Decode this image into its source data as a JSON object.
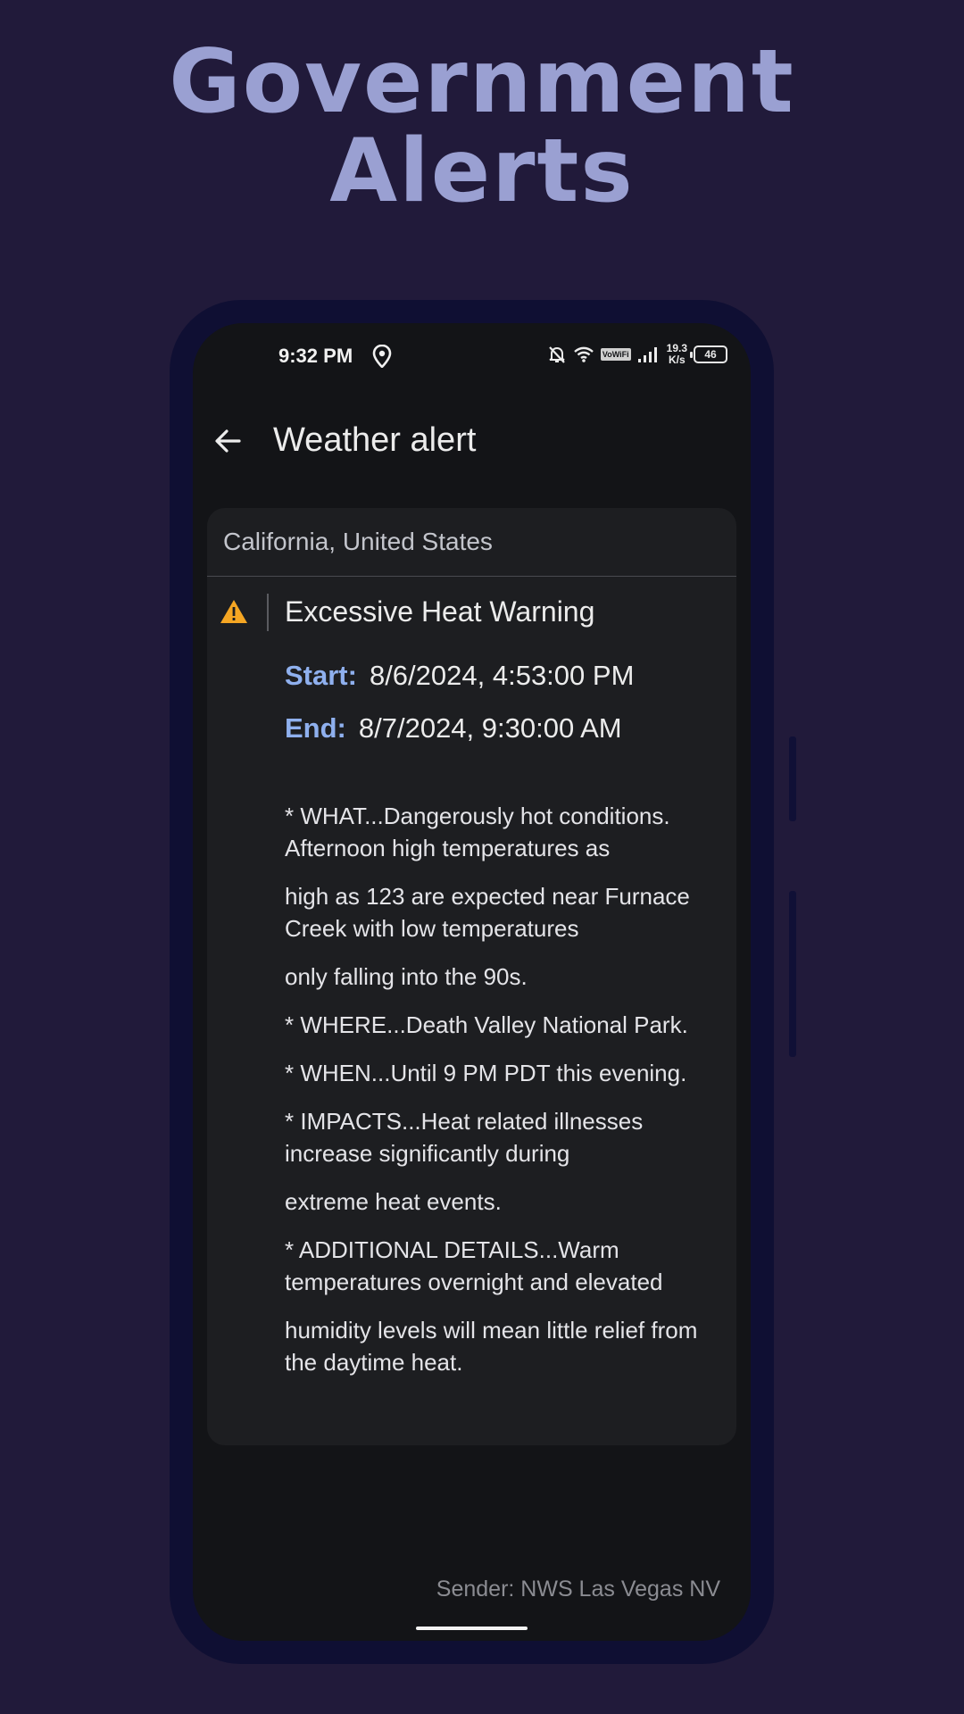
{
  "promo": {
    "title_line1": "Government",
    "title_line2": "Alerts"
  },
  "status_bar": {
    "time": "9:32 PM",
    "vowifi": "VoWiFi",
    "speed_value": "19.3",
    "speed_unit": "K/s",
    "battery": "46"
  },
  "toolbar": {
    "title": "Weather alert"
  },
  "alert": {
    "region": "California, United States",
    "event": "Excessive Heat Warning",
    "start_label": "Start:",
    "start_value": "8/6/2024, 4:53:00 PM",
    "end_label": "End:",
    "end_value": "8/7/2024, 9:30:00 AM",
    "description": [
      "* WHAT...Dangerously hot conditions. Afternoon high temperatures as",
      "high as 123 are expected near Furnace Creek with low temperatures",
      "only falling into the 90s.",
      "* WHERE...Death Valley National Park.",
      "* WHEN...Until 9 PM PDT this evening.",
      "* IMPACTS...Heat related illnesses increase significantly during",
      "extreme heat events.",
      "* ADDITIONAL DETAILS...Warm temperatures overnight and elevated",
      "humidity levels will mean little relief from the daytime heat."
    ],
    "sender": "Sender: NWS Las Vegas NV"
  },
  "colors": {
    "background": "#211a3a",
    "title": "#9aa0d2",
    "label_accent": "#8fb0ee",
    "warning": "#f5a623"
  },
  "icons": [
    "location-pin-icon",
    "bell-off-icon",
    "wifi-icon",
    "signal-icon",
    "battery-icon",
    "back-arrow-icon",
    "warning-icon"
  ]
}
